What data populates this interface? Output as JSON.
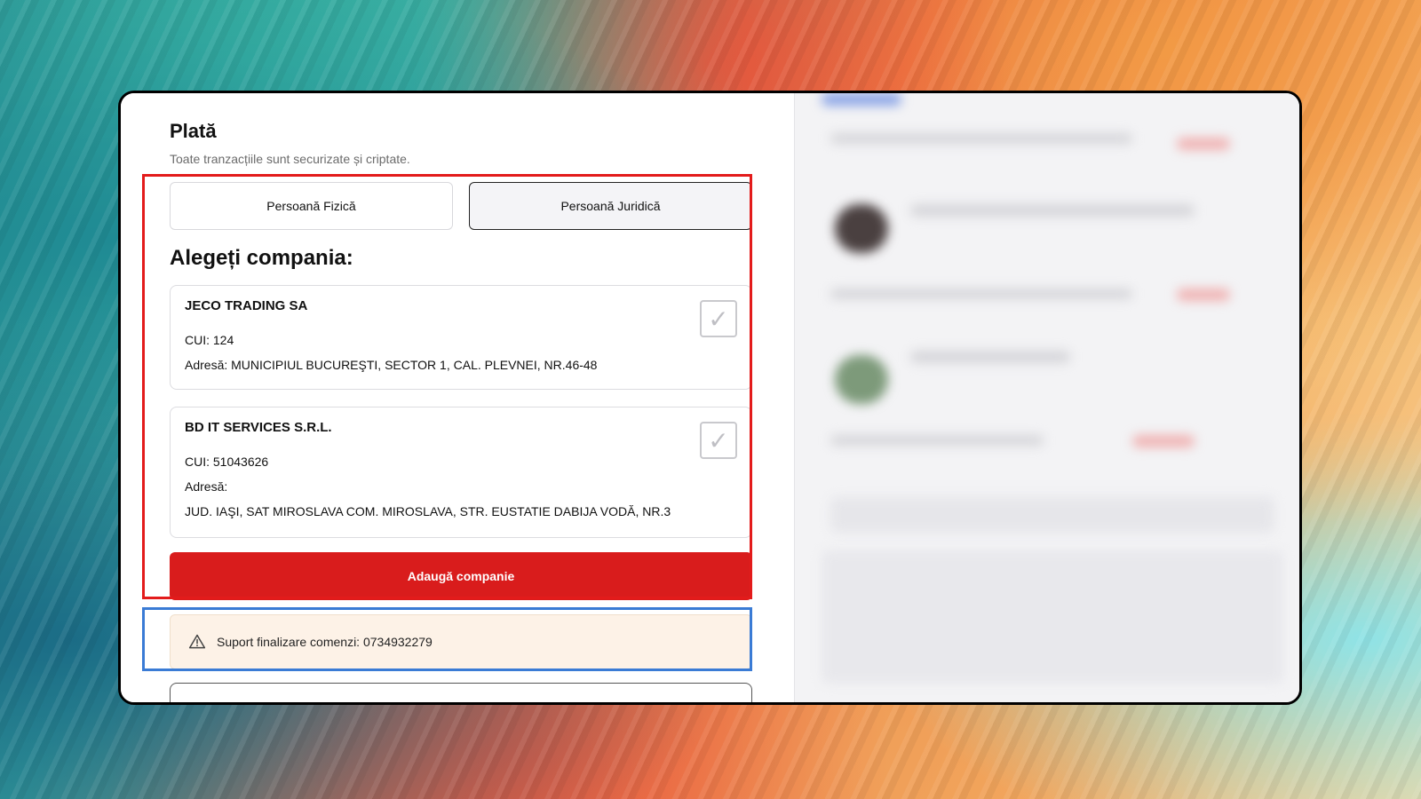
{
  "header": {
    "title": "Plată",
    "subtitle": "Toate tranzacțiile sunt securizate și criptate."
  },
  "person_type_toggle": {
    "options": [
      "Persoană Fizică",
      "Persoană Juridică"
    ],
    "selected": "Persoană Juridică"
  },
  "companies": {
    "heading": "Alegeți compania:",
    "items": [
      {
        "name": "JECO TRADING SA",
        "cui": "CUI: 124",
        "address": "Adresă: MUNICIPIUL BUCUREŞTI, SECTOR 1, CAL. PLEVNEI, NR.46-48"
      },
      {
        "name": "BD IT SERVICES S.R.L.",
        "cui": "CUI: 51043626",
        "address_label": "Adresă:",
        "address": "JUD. IAŞI, SAT MIROSLAVA COM. MIROSLAVA, STR. EUSTATIE DABIJA VODĂ, NR.3"
      }
    ],
    "add_button_label": "Adaugă companie"
  },
  "support": {
    "text": "Suport finalizare comenzi: 0734932279",
    "icon": "warning-icon"
  },
  "colors": {
    "accent_red": "#d91c1c",
    "support_bg": "#fdf2e7",
    "highlight_red": "#e31b1b",
    "highlight_blue": "#3a7bd5"
  }
}
